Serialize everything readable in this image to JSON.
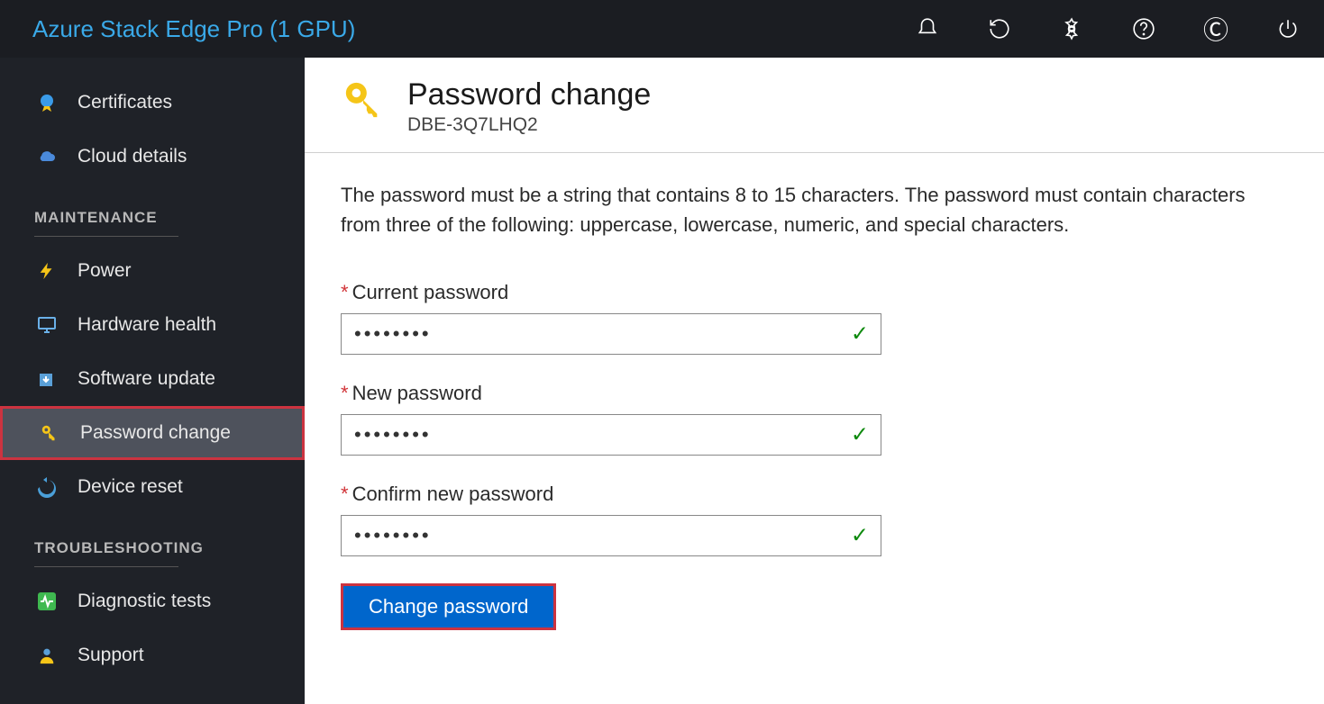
{
  "header": {
    "title": "Azure Stack Edge Pro (1 GPU)"
  },
  "sidebar": {
    "items_top": [
      {
        "label": "Certificates",
        "icon": "certificate"
      },
      {
        "label": "Cloud details",
        "icon": "cloud"
      }
    ],
    "section_maintenance": "MAINTENANCE",
    "items_maintenance": [
      {
        "label": "Power",
        "icon": "power"
      },
      {
        "label": "Hardware health",
        "icon": "monitor"
      },
      {
        "label": "Software update",
        "icon": "update"
      },
      {
        "label": "Password change",
        "icon": "key",
        "active": true
      },
      {
        "label": "Device reset",
        "icon": "reset"
      }
    ],
    "section_troubleshooting": "TROUBLESHOOTING",
    "items_troubleshooting": [
      {
        "label": "Diagnostic tests",
        "icon": "diag"
      },
      {
        "label": "Support",
        "icon": "support"
      }
    ]
  },
  "page": {
    "title": "Password change",
    "subtitle": "DBE-3Q7LHQ2",
    "description": "The password must be a string that contains 8 to 15 characters. The password must contain characters from three of the following: uppercase, lowercase, numeric, and special characters."
  },
  "form": {
    "current_label": "Current password",
    "current_value": "••••••••",
    "new_label": "New password",
    "new_value": "••••••••",
    "confirm_label": "Confirm new password",
    "confirm_value": "••••••••",
    "submit": "Change password"
  }
}
